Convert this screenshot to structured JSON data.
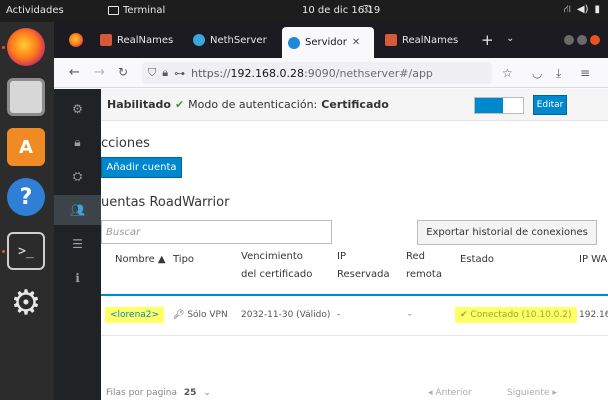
{
  "topbar": {
    "activities": "Actividades",
    "app_name": "Terminal",
    "clock": "10 de dic  16:19"
  },
  "dock": {
    "items": [
      "firefox-icon",
      "files-icon",
      "software-icon",
      "help-icon",
      "terminal-icon",
      "settings-icon"
    ],
    "help_glyph": "?",
    "terminal_glyph": ">_"
  },
  "browser": {
    "tabs": [
      {
        "label": "RealNames",
        "active": false,
        "favicon_color": "#d35b3a"
      },
      {
        "label": "NethServer",
        "active": false,
        "favicon_color": "#3aa7e0"
      },
      {
        "label": "Servidor",
        "active": true,
        "favicon_color": "#1e88d9"
      },
      {
        "label": "RealNames",
        "active": false,
        "favicon_color": "#d35b3a"
      }
    ],
    "url_prefix": "https://",
    "url_host": "192.168.0.28",
    "url_path": ":9090/nethserver#/app"
  },
  "cockpit": {
    "auth_label": "Habilitado",
    "auth_mode_label": "Modo de autenticación:",
    "auth_mode_value": "Certificado",
    "toggle_on": true,
    "edit_button": "Editar",
    "accounts_title": "cciones",
    "add_account_button": "Añadir cuenta",
    "roadwarrior_title": "uentas RoadWarrior",
    "search_placeholder": "Buscar",
    "export_button": "Exportar historial de conexiones",
    "columns": [
      {
        "label": "Nombre ▲"
      },
      {
        "label": "Tipo"
      },
      {
        "label": "Vencimiento del certificado"
      },
      {
        "label": "IP Reservada"
      },
      {
        "label": "Red remota"
      },
      {
        "label": "Estado"
      },
      {
        "label": "IP WA"
      }
    ],
    "row": {
      "name": "<lorena2>",
      "type": "Sólo VPN",
      "expiry": "2032-11-30 (Válido)",
      "reserved_ip": "-",
      "remote_net": "-",
      "status": "Conectado (10.10.0.2)",
      "ip_wan": "192.16"
    },
    "pager": {
      "rows_label": "Filas por pagina",
      "rows_value": "25",
      "prev": "Anterior",
      "next": "Siguiente"
    },
    "accent_color": "#0088ce"
  }
}
